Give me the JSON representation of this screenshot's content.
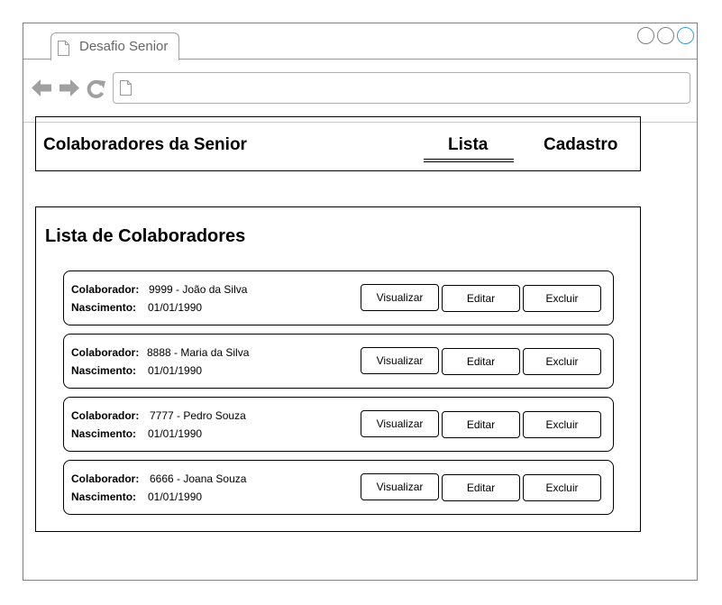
{
  "browser": {
    "tab_title": "Desafio Senior",
    "address_value": ""
  },
  "header": {
    "title": "Colaboradores da Senior",
    "nav": [
      {
        "label": "Lista",
        "active": true
      },
      {
        "label": "Cadastro",
        "active": false
      }
    ]
  },
  "list": {
    "title": "Lista de Colaboradores",
    "label_colaborador": "Colaborador:",
    "label_nascimento": "Nascimento:",
    "actions": {
      "view": "Visualizar",
      "edit": "Editar",
      "delete": "Excluir"
    },
    "items": [
      {
        "colaborador": "9999 - João da Silva",
        "nascimento": "01/01/1990"
      },
      {
        "colaborador": "8888 - Maria da Silva",
        "nascimento": "01/01/1990"
      },
      {
        "colaborador": "7777 - Pedro Souza",
        "nascimento": "01/01/1990"
      },
      {
        "colaborador": "6666 - Joana Souza",
        "nascimento": "01/01/1990"
      }
    ]
  },
  "colors": {
    "accent_window_control": "#3a9bdc"
  }
}
